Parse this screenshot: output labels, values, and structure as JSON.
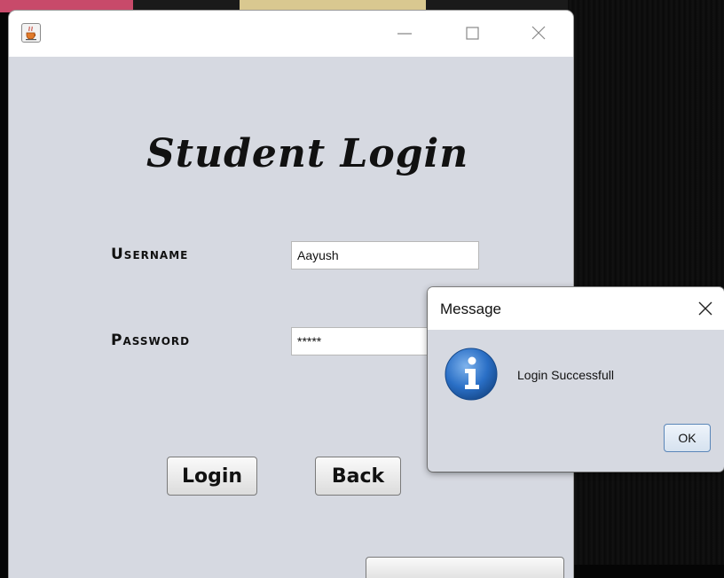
{
  "window": {
    "title_heading": "Student Login",
    "icon": "java-cup-icon",
    "controls": [
      "minimize-icon",
      "maximize-icon",
      "close-icon"
    ]
  },
  "form": {
    "username_label": "Username",
    "username_value": "Aayush",
    "password_label": "Password",
    "password_value": "*****"
  },
  "buttons": {
    "login_label": "Login",
    "back_label": "Back"
  },
  "dialog": {
    "title": "Message",
    "icon": "info-icon",
    "message": "Login Successfull",
    "ok_label": "OK"
  },
  "colors": {
    "window_bg": "#d6d9e1",
    "titlebar_bg": "#ffffff",
    "info_icon_blue": "#2a6fc6"
  }
}
